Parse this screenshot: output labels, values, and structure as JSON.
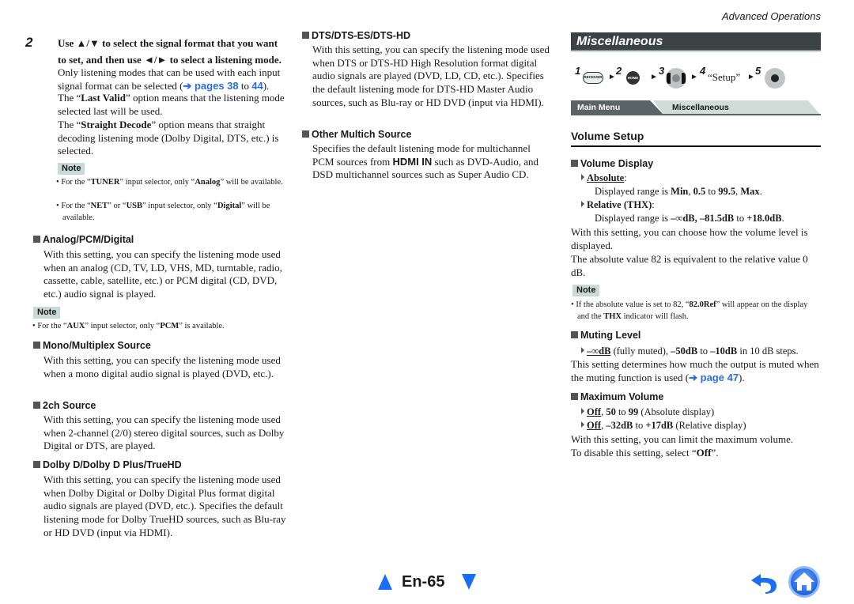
{
  "header": {
    "section": "Advanced Operations",
    "misc_title": "Miscellaneous"
  },
  "left": {
    "step_number": "2",
    "step_title_a": "Use ▲/▼ to select the signal format that you want to set, and then use ◄/► to select a listening mode.",
    "intro_a": "Only listening modes that can be used with each input signal format can be selected (",
    "intro_link": "➔ pages 38",
    "intro_to": " to ",
    "intro_link2": "44",
    "intro_end": ").",
    "last_valid_pre": "The “",
    "last_valid_bold": "Last Valid",
    "last_valid_post": "” option means that the listening mode selected last will be used.",
    "straight_pre": "The “",
    "straight_bold": "Straight Decode",
    "straight_post": "” option means that straight decoding listening mode (Dolby Digital, DTS, etc.) is selected.",
    "note1_label": "Note",
    "note1_items": [
      {
        "pre": "For the “",
        "b1": "TUNER",
        "mid": "” input selector, only “",
        "b2": "Analog",
        "post": "” will be available."
      },
      {
        "pre": "For the “",
        "b1": "NET",
        "mid": "” or “",
        "b2": "USB",
        "mid2": "” input selector, only “",
        "b3": "Digital",
        "post": "” will be available."
      }
    ],
    "sections": [
      {
        "title": "Analog/PCM/Digital",
        "body": "With this setting, you can specify the listening mode used when an analog (CD, TV, LD, VHS, MD, turntable, radio, cassette, cable, satellite, etc.) or PCM digital (CD, DVD, etc.) audio signal is played."
      },
      {
        "title": "Mono/Multiplex Source",
        "body": "With this setting, you can specify the listening mode used when a mono digital audio signal is played (DVD, etc.)."
      },
      {
        "title": "2ch Source",
        "body": "With this setting, you can specify the listening mode used when 2-channel (2/0) stereo digital sources, such as Dolby Digital or DTS, are played."
      },
      {
        "title": "Dolby D/Dolby D Plus/TrueHD",
        "body": "With this setting, you can specify the listening mode used when Dolby Digital or Dolby Digital Plus format digital audio signals are played (DVD, etc.). Specifies the default listening mode for Dolby TrueHD sources, such as Blu-ray or HD DVD (input via HDMI)."
      }
    ],
    "note2_label": "Note",
    "note2_item": {
      "pre": "For the “",
      "b1": "AUX",
      "mid": "” input selector, only “",
      "b2": "PCM",
      "post": "” is available."
    }
  },
  "middle": {
    "sections": [
      {
        "title": "DTS/DTS-ES/DTS-HD",
        "body": "With this setting, you can specify the listening mode used when DTS or DTS-HD High Resolution format digital audio signals are played (DVD, LD, CD, etc.). Specifies the default listening mode for DTS-HD Master Audio sources, such as Blu-ray or HD DVD (input via HDMI)."
      },
      {
        "title": "Other Multich Source",
        "body_pre": "Specifies the default listening mode for multichannel PCM sources from ",
        "body_bold": "HDMI IN",
        "body_post": " such as DVD-Audio, and DSD multichannel sources such as Super Audio CD."
      }
    ]
  },
  "right": {
    "steps": [
      {
        "num": "1",
        "button": "RECEIVER"
      },
      {
        "num": "2",
        "button": "HOME"
      },
      {
        "num": "3",
        "button": "ENTER"
      },
      {
        "num": "4",
        "label": "“Setup”"
      },
      {
        "num": "5",
        "button": "ENTER"
      }
    ],
    "breadcrumb": [
      "Main Menu",
      "Miscellaneous"
    ],
    "volume_setup_title": "Volume Setup",
    "volume_display": {
      "title": "Volume Display",
      "opt1_label": "Absolute",
      "opt1_desc_pre": "Displayed range is ",
      "opt1_desc_b1": "Min",
      "opt1_desc_c": ", ",
      "opt1_desc_b2": "0.5",
      "opt1_desc_to": " to ",
      "opt1_desc_b3": "99.5",
      "opt1_desc_c2": ", ",
      "opt1_desc_b4": "Max",
      "opt1_desc_end": ".",
      "opt2_label": "Relative (THX)",
      "opt2_desc_pre": "Displayed range is ",
      "opt2_desc_b1": "–∞dB, –81.5dB",
      "opt2_desc_to": " to ",
      "opt2_desc_b2": "+18.0dB",
      "opt2_desc_end": ".",
      "body1": "With this setting, you can choose how the volume level is displayed.",
      "body2": "The absolute value 82 is equivalent to the relative value 0 dB."
    },
    "note_label": "Note",
    "note_item": {
      "pre": "If the absolute value is set to 82, “",
      "b1": "82.0Ref",
      "mid": "” will appear on the display and the ",
      "b2": "THX",
      "post": " indicator will flash."
    },
    "muting_level": {
      "title": "Muting Level",
      "opt_default": "–∞dB",
      "opt_mid": " (fully muted), ",
      "opt_b1": "–50dB",
      "opt_to": " to ",
      "opt_b2": "–10dB",
      "opt_end": " in 10 dB steps.",
      "body_pre": "This setting determines how much the output is muted when the muting function is used (",
      "body_link": "➔ page 47",
      "body_end": ")."
    },
    "maximum_volume": {
      "title": "Maximum Volume",
      "opt1_default": "Off",
      "opt1_c": ", ",
      "opt1_b1": "50",
      "opt1_to": " to ",
      "opt1_b2": "99",
      "opt1_end": " (Absolute display)",
      "opt2_default": "Off",
      "opt2_c": ", ",
      "opt2_b1": "–32dB",
      "opt2_to": " to ",
      "opt2_b2": "+17dB",
      "opt2_end": " (Relative display)",
      "body1": "With this setting, you can limit the maximum volume.",
      "body2_pre": "To disable this setting, select “",
      "body2_bold": "Off",
      "body2_end": "”."
    }
  },
  "footer": {
    "page_number": "En-65",
    "prev_icon": "triangle-up",
    "next_icon": "triangle-down",
    "back_icon": "return-arrow",
    "home_icon": "home",
    "accent_color": "#1a6ef5"
  }
}
